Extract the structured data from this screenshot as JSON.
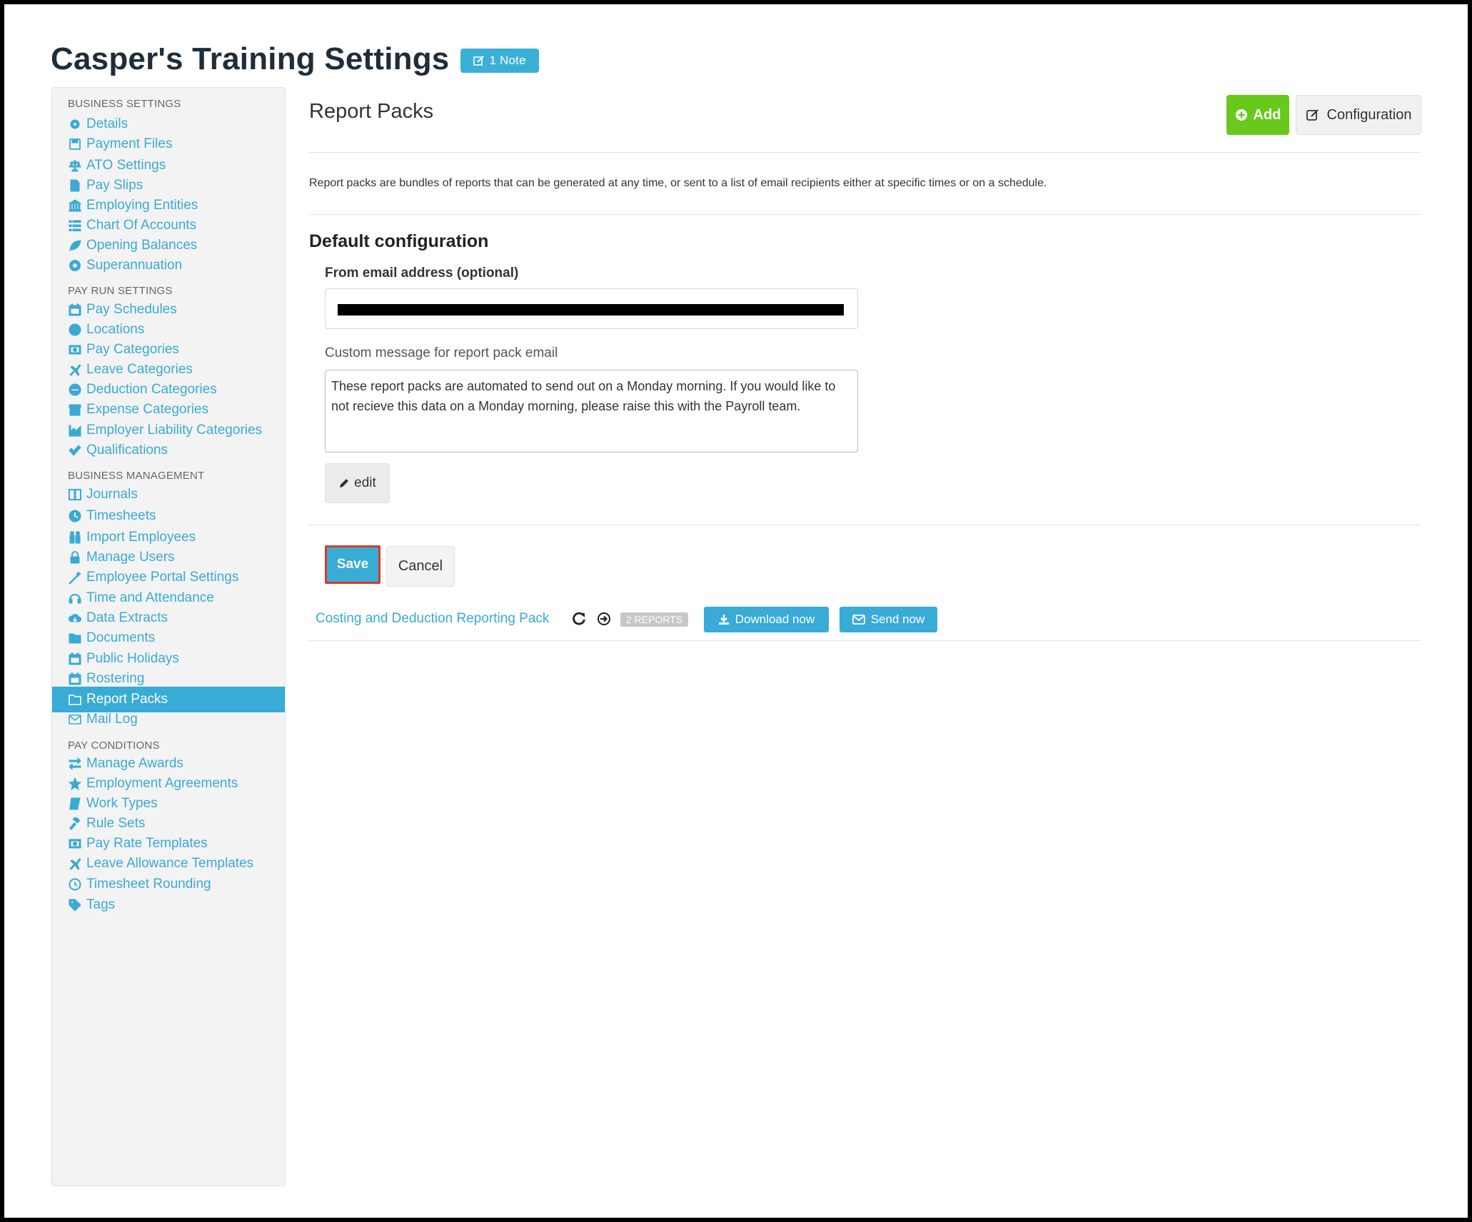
{
  "header": {
    "title": "Casper's Training Settings",
    "note_badge": "1 Note"
  },
  "sidebar": {
    "sections": [
      {
        "title": "BUSINESS SETTINGS",
        "items": [
          {
            "label": "Details",
            "icon": "gear-icon"
          },
          {
            "label": "Payment Files",
            "icon": "floppy-icon"
          },
          {
            "label": "ATO Settings",
            "icon": "scales-icon"
          },
          {
            "label": "Pay Slips",
            "icon": "file-icon"
          },
          {
            "label": "Employing Entities",
            "icon": "bank-icon"
          },
          {
            "label": "Chart Of Accounts",
            "icon": "list-icon"
          },
          {
            "label": "Opening Balances",
            "icon": "leaf-icon"
          },
          {
            "label": "Superannuation",
            "icon": "life-ring-icon"
          }
        ]
      },
      {
        "title": "PAY RUN SETTINGS",
        "items": [
          {
            "label": "Pay Schedules",
            "icon": "calendar-icon"
          },
          {
            "label": "Locations",
            "icon": "globe-icon"
          },
          {
            "label": "Pay Categories",
            "icon": "money-icon"
          },
          {
            "label": "Leave Categories",
            "icon": "plane-icon"
          },
          {
            "label": "Deduction Categories",
            "icon": "minus-circle-icon"
          },
          {
            "label": "Expense Categories",
            "icon": "archive-icon"
          },
          {
            "label": "Employer Liability Categories",
            "icon": "area-chart-icon"
          },
          {
            "label": "Qualifications",
            "icon": "check-icon"
          }
        ]
      },
      {
        "title": "BUSINESS MANAGEMENT",
        "items": [
          {
            "label": "Journals",
            "icon": "columns-icon"
          },
          {
            "label": "Timesheets",
            "icon": "clock-icon"
          },
          {
            "label": "Import Employees",
            "icon": "users-icon"
          },
          {
            "label": "Manage Users",
            "icon": "lock-icon"
          },
          {
            "label": "Employee Portal Settings",
            "icon": "magic-wand-icon"
          },
          {
            "label": "Time and Attendance",
            "icon": "headset-icon"
          },
          {
            "label": "Data Extracts",
            "icon": "cloud-download-icon"
          },
          {
            "label": "Documents",
            "icon": "folder-icon"
          },
          {
            "label": "Public Holidays",
            "icon": "calendar-icon"
          },
          {
            "label": "Rostering",
            "icon": "calendar-icon"
          },
          {
            "label": "Report Packs",
            "icon": "folder-open-icon",
            "active": true
          },
          {
            "label": "Mail Log",
            "icon": "envelope-icon"
          }
        ]
      },
      {
        "title": "PAY CONDITIONS",
        "items": [
          {
            "label": "Manage Awards",
            "icon": "exchange-icon"
          },
          {
            "label": "Employment Agreements",
            "icon": "star-icon"
          },
          {
            "label": "Work Types",
            "icon": "book-icon"
          },
          {
            "label": "Rule Sets",
            "icon": "gavel-icon"
          },
          {
            "label": "Pay Rate Templates",
            "icon": "money-icon"
          },
          {
            "label": "Leave Allowance Templates",
            "icon": "plane-icon"
          },
          {
            "label": "Timesheet Rounding",
            "icon": "clock-outline-icon"
          },
          {
            "label": "Tags",
            "icon": "tag-icon"
          }
        ]
      }
    ]
  },
  "main": {
    "title": "Report Packs",
    "add_label": "Add",
    "configuration_label": "Configuration",
    "description": "Report packs are bundles of reports that can be generated at any time, or sent to a list of email recipients either at specific times or on a schedule.",
    "default_config_heading": "Default configuration",
    "from_email_label": "From email address (optional)",
    "custom_message_label": "Custom message for report pack email",
    "custom_message": "These report packs are automated to send out on a Monday morning. If you would like to not recieve this data on a Monday morning, please raise this with the Payroll team.",
    "edit_label": "edit",
    "save_label": "Save",
    "cancel_label": "Cancel"
  },
  "report_pack": {
    "name": "Costing and Deduction Reporting Pack",
    "reports_badge": "2 REPORTS",
    "download_label": "Download now",
    "send_label": "Send now"
  },
  "colors": {
    "accent": "#38abd6",
    "link": "#3aaad4",
    "add_green": "#66c91c",
    "highlight_red": "#dc3a22"
  }
}
